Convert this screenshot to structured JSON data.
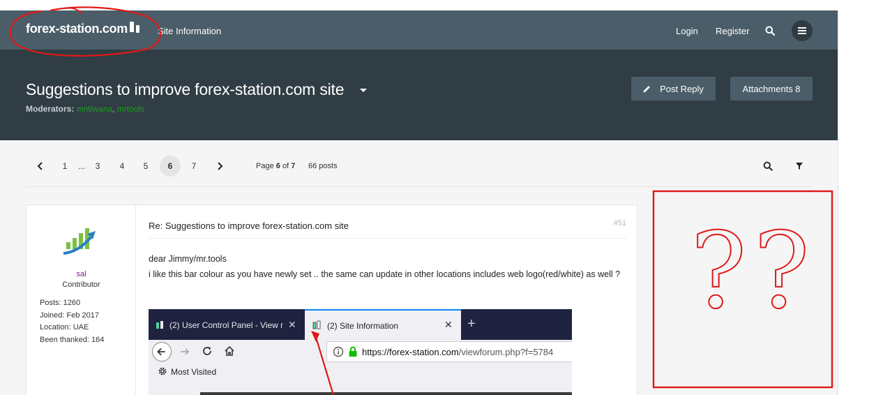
{
  "nav": {
    "logo_text": "forex-station.com",
    "site_info": "Site Information",
    "login": "Login",
    "register": "Register"
  },
  "header": {
    "title": "Suggestions to improve forex-station.com site",
    "moderators_label": "Moderators:",
    "moderators": [
      "mntiwana",
      "mrtools"
    ],
    "post_reply": "Post Reply",
    "attachments": "Attachments 8"
  },
  "pagination": {
    "pages": [
      "1",
      "...",
      "3",
      "4",
      "5",
      "6",
      "7"
    ],
    "active": "6",
    "info_prefix": "Page",
    "current": "6",
    "info_of": "of",
    "total": "7",
    "post_count": "66 posts"
  },
  "post": {
    "username": "sal",
    "rank": "Contributor",
    "stats": [
      "Posts: 1260",
      "Joined: Feb 2017",
      "Location: UAE",
      "Been thanked: 164"
    ],
    "subject": "Re: Suggestions to improve forex-station.com site",
    "number": "#51",
    "line1": "dear Jimmy/mr.tools",
    "line2": "i like this bar colour as you have newly set .. the same can update in other locations includes web logo(red/white) as well ?"
  },
  "screenshot": {
    "tab1": "(2) User Control Panel - View m",
    "tab2": "(2) Site Information",
    "url_host": "https://forex-station.com",
    "url_path": "/viewforum.php?f=5784",
    "bookmarks": "Most Visited"
  },
  "annotation": {
    "text": "??",
    "color": "#e01818"
  },
  "colors": {
    "nav_bg": "#4a5d68",
    "header_bg": "#303d44",
    "moderator_link": "#19a01c",
    "username": "#7a1e86"
  }
}
